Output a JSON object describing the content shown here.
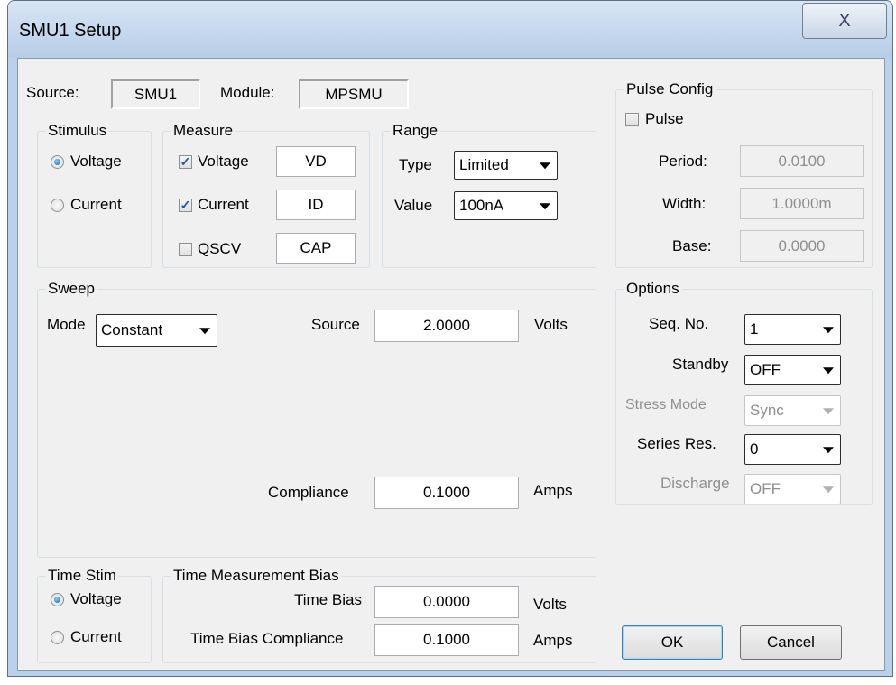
{
  "window": {
    "title": "SMU1 Setup",
    "close_glyph": "X"
  },
  "source": {
    "label": "Source:",
    "value": "SMU1",
    "module_label": "Module:",
    "module_value": "MPSMU"
  },
  "stimulus": {
    "title": "Stimulus",
    "voltage": "Voltage",
    "current": "Current",
    "selected": "Voltage"
  },
  "measure": {
    "title": "Measure",
    "rows": [
      {
        "label": "Voltage",
        "checked": true,
        "value": "VD"
      },
      {
        "label": "Current",
        "checked": true,
        "value": "ID"
      },
      {
        "label": "QSCV",
        "checked": false,
        "value": "CAP"
      }
    ],
    "check_glyph": "✓"
  },
  "range": {
    "title": "Range",
    "type_label": "Type",
    "type_value": "Limited",
    "value_label": "Value",
    "value_value": "100nA"
  },
  "pulse": {
    "title": "Pulse Config",
    "checkbox_label": "Pulse",
    "checked": false,
    "period_label": "Period:",
    "period_value": "0.0100",
    "width_label": "Width:",
    "width_value": "1.0000m",
    "base_label": "Base:",
    "base_value": "0.0000"
  },
  "sweep": {
    "title": "Sweep",
    "mode_label": "Mode",
    "mode_value": "Constant",
    "source_label": "Source",
    "source_value": "2.0000",
    "source_unit": "Volts",
    "compliance_label": "Compliance",
    "compliance_value": "0.1000",
    "compliance_unit": "Amps"
  },
  "options": {
    "title": "Options",
    "seq_label": "Seq. No.",
    "seq_value": "1",
    "standby_label": "Standby",
    "standby_value": "OFF",
    "stress_label": "Stress Mode",
    "stress_value": "Sync",
    "series_label": "Series Res.",
    "series_value": "0",
    "discharge_label": "Discharge",
    "discharge_value": "OFF"
  },
  "time_stim": {
    "title": "Time Stim",
    "voltage": "Voltage",
    "current": "Current",
    "selected": "Voltage"
  },
  "time_bias": {
    "title": "Time Measurement Bias",
    "bias_label": "Time Bias",
    "bias_value": "0.0000",
    "bias_unit": "Volts",
    "compliance_label": "Time Bias Compliance",
    "compliance_value": "0.1000",
    "compliance_unit": "Amps"
  },
  "buttons": {
    "ok": "OK",
    "cancel": "Cancel"
  }
}
